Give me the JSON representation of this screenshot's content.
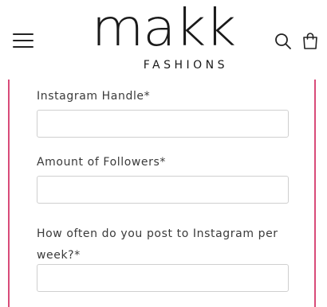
{
  "header": {
    "menu_icon": "hamburger-menu-icon",
    "logo_main": "makk",
    "logo_sub": "FASHIONS",
    "search_icon": "search-icon",
    "bag_icon": "shopping-bag-icon"
  },
  "form": {
    "accent_color": "#d84b79",
    "fields": [
      {
        "label": "Instagram Handle*",
        "value": "",
        "placeholder": ""
      },
      {
        "label": "Amount of Followers*",
        "value": "",
        "placeholder": ""
      },
      {
        "label": "How often do you post to Instagram per week?*",
        "value": "",
        "placeholder": ""
      }
    ]
  }
}
